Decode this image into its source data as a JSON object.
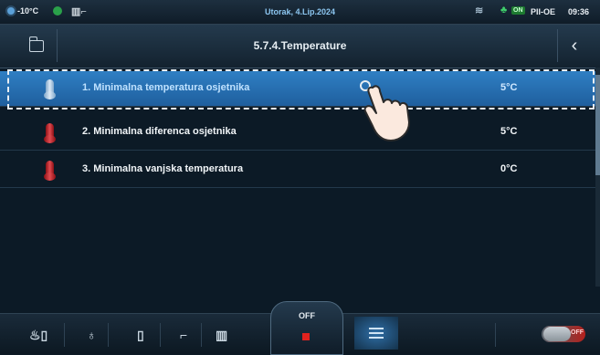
{
  "status": {
    "outside_temp": "-10°C",
    "date": "Utorak, 4.Lip.2024",
    "on_badge": "ON",
    "mode": "PII-OE",
    "time": "09:36"
  },
  "header": {
    "title": "5.7.4.Temperature",
    "back_icon": "‹"
  },
  "list": {
    "items": [
      {
        "label": "1. Minimalna temperatura osjetnika",
        "value": "5°C",
        "icon": "thermometer-icon",
        "selected": true
      },
      {
        "label": "2. Minimalna diferenca osjetnika",
        "value": "5°C",
        "icon": "thermometer-icon",
        "selected": false
      },
      {
        "label": "3. Minimalna vanjska temperatura",
        "value": "0°C",
        "icon": "thermometer-icon",
        "selected": false
      }
    ]
  },
  "bottom": {
    "off_label": "OFF",
    "toggle_label": "OFF"
  },
  "colors": {
    "accent": "#2f7fc4",
    "background": "#0c1a26",
    "stop": "#e0221e"
  }
}
